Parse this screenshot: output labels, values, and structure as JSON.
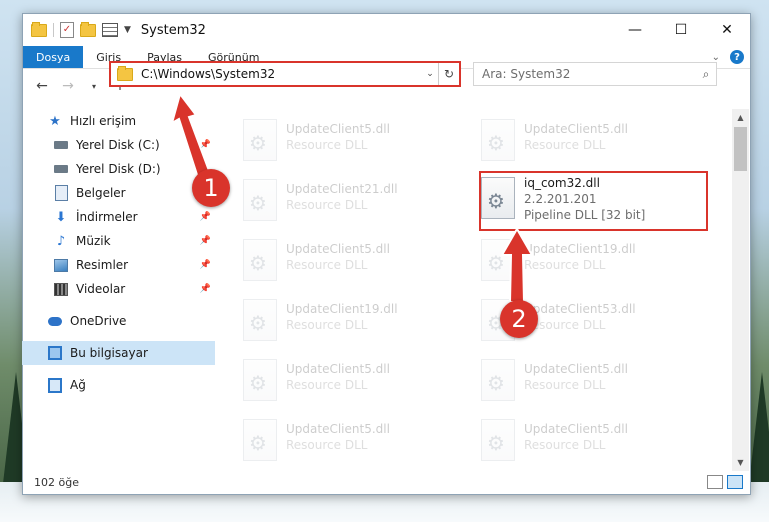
{
  "window": {
    "title": "System32"
  },
  "ribbon": {
    "tabs": [
      "Dosya",
      "Giriş",
      "Paylaş",
      "Görünüm"
    ]
  },
  "address": {
    "path": "C:\\Windows\\System32"
  },
  "search": {
    "placeholder": "Ara: System32"
  },
  "sidebar": {
    "items": [
      {
        "label": "Hızlı erişim",
        "icon": "star-icon"
      },
      {
        "label": "Yerel Disk (C:)",
        "icon": "disk-icon",
        "pinned": true
      },
      {
        "label": "Yerel Disk (D:)",
        "icon": "disk-icon",
        "pinned": false
      },
      {
        "label": "Belgeler",
        "icon": "documents-icon",
        "pinned": false
      },
      {
        "label": "İndirmeler",
        "icon": "download-icon",
        "pinned": true
      },
      {
        "label": "Müzik",
        "icon": "music-icon",
        "pinned": true
      },
      {
        "label": "Resimler",
        "icon": "pictures-icon",
        "pinned": true
      },
      {
        "label": "Videolar",
        "icon": "videos-icon",
        "pinned": true
      },
      {
        "label": "OneDrive",
        "icon": "cloud-icon"
      },
      {
        "label": "Bu bilgisayar",
        "icon": "computer-icon",
        "selected": true
      },
      {
        "label": "Ağ",
        "icon": "network-icon"
      }
    ]
  },
  "files": [
    {
      "name": "UpdateClient5.dll",
      "sub": "Resource DLL"
    },
    {
      "name": "UpdateClient5.dll",
      "sub": "Resource DLL"
    },
    {
      "name": "UpdateClient21.dll",
      "sub": "Resource DLL"
    },
    {
      "name": "iq_com32.dll",
      "version": "2.2.201.201",
      "sub": "Pipeline DLL [32 bit]",
      "highlighted": true
    },
    {
      "name": "UpdateClient5.dll",
      "sub": "Resource DLL"
    },
    {
      "name": "UpdateClient19.dll",
      "sub": "Resource DLL"
    },
    {
      "name": "UpdateClient19.dll",
      "sub": "Resource DLL"
    },
    {
      "name": "UpdateClient53.dll",
      "sub": "Resource DLL"
    },
    {
      "name": "UpdateClient5.dll",
      "sub": "Resource DLL"
    },
    {
      "name": "UpdateClient5.dll",
      "sub": "Resource DLL"
    },
    {
      "name": "UpdateClient5.dll",
      "sub": "Resource DLL"
    },
    {
      "name": "UpdateClient5.dll",
      "sub": "Resource DLL"
    }
  ],
  "status": {
    "count": "102 öğe"
  },
  "markers": [
    "1",
    "2"
  ],
  "colors": {
    "accent": "#1979ca",
    "highlight": "#d9342b"
  }
}
